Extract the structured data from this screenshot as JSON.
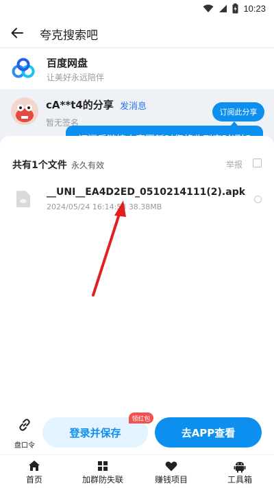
{
  "status_bar": {
    "time": "10:23"
  },
  "header": {
    "title": "夸克搜索吧"
  },
  "app": {
    "name": "百度网盘",
    "slogan": "让美好永远陪伴"
  },
  "share": {
    "sharer": "cA**t4的分享",
    "send_message": "发消息",
    "signature": "暂无签名",
    "subscribe_label": "订阅此分享",
    "tooltip": "订阅后链接内容更新时您将收到实时通知"
  },
  "files": {
    "count_label": "共有1个文件",
    "validity": "永久有效",
    "report_label": "举报",
    "items": [
      {
        "name": "__UNI__EA4D2ED_0510214111(2).apk",
        "date": "2024/05/24 16:14:53",
        "size": "38.38MB"
      }
    ]
  },
  "actions": {
    "pan_code_label": "盘口令",
    "login_save_label": "登录并保存",
    "red_packet_badge": "领红包",
    "app_view_label": "去APP查看"
  },
  "bottom_nav": [
    {
      "label": "首页",
      "icon": "home-icon"
    },
    {
      "label": "加群防失联",
      "icon": "grid-icon"
    },
    {
      "label": "赚钱项目",
      "icon": "heart-icon"
    },
    {
      "label": "工具箱",
      "icon": "android-icon"
    }
  ],
  "colors": {
    "accent": "#0d8ff0",
    "badge_red": "#f35050",
    "light_blue_btn": "#e3f3ff"
  }
}
